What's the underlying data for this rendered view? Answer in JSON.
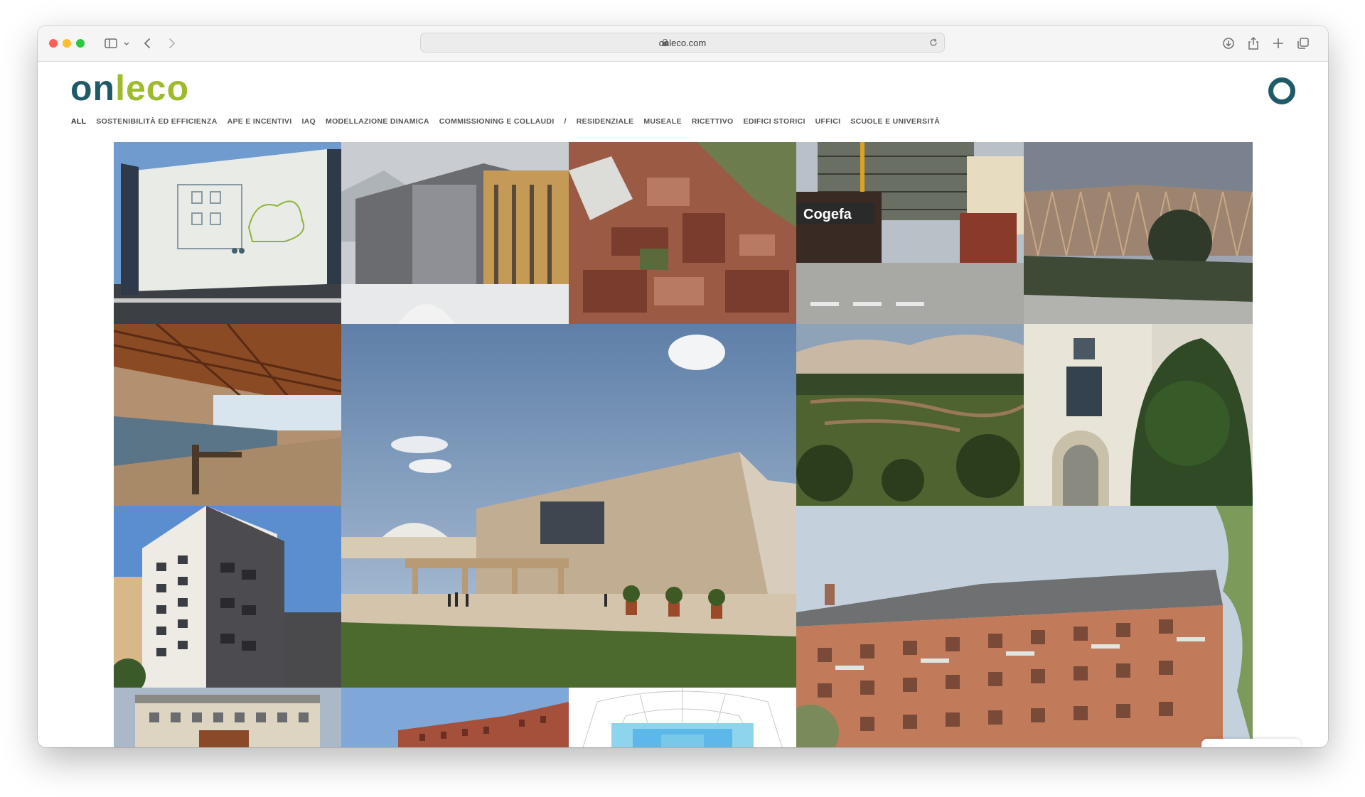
{
  "browser": {
    "url": "onleco.com",
    "traffic_lights": [
      "#fe5f57",
      "#febc2e",
      "#28c840"
    ],
    "icons": [
      "sidebar-icon",
      "chevron-down-icon",
      "back-icon",
      "forward-icon",
      "lock-icon",
      "reload-icon",
      "download-icon",
      "share-icon",
      "new-tab-icon",
      "tabs-overview-icon"
    ]
  },
  "site": {
    "logo_part1": "on",
    "logo_part2": "leco",
    "brand_colors": {
      "teal": "#1f5a68",
      "green": "#9dbb2a"
    },
    "filters": [
      "ALL",
      "SOSTENIBILITÀ ED EFFICIENZA",
      "APE E INCENTIVI",
      "IAQ",
      "MODELLAZIONE DINAMICA",
      "COMMISSIONING E COLLAUDI",
      "/",
      "RESIDENZIALE",
      "MUSEALE",
      "RICETTIVO",
      "EDIFICI STORICI",
      "UFFICI",
      "SCUOLE E UNIVERSITÀ"
    ],
    "active_filter": "ALL"
  },
  "projects": [
    {
      "name": "project-tile-facade-banner",
      "sign_text": "Cogefa"
    },
    {
      "name": "project-tile-mountain-housing"
    },
    {
      "name": "project-tile-aerial-view"
    },
    {
      "name": "project-tile-cogefa-site",
      "sign_text": "Cogefa"
    },
    {
      "name": "project-tile-lattice-pavilion"
    },
    {
      "name": "project-tile-swimming-pool"
    },
    {
      "name": "project-tile-civic-center"
    },
    {
      "name": "project-tile-landscape-park"
    },
    {
      "name": "project-tile-classic-facade"
    },
    {
      "name": "project-tile-apartment-tower"
    },
    {
      "name": "project-tile-brick-residence"
    },
    {
      "name": "project-tile-modern-block"
    },
    {
      "name": "project-tile-red-building"
    },
    {
      "name": "project-tile-thermal-diagram"
    }
  ]
}
